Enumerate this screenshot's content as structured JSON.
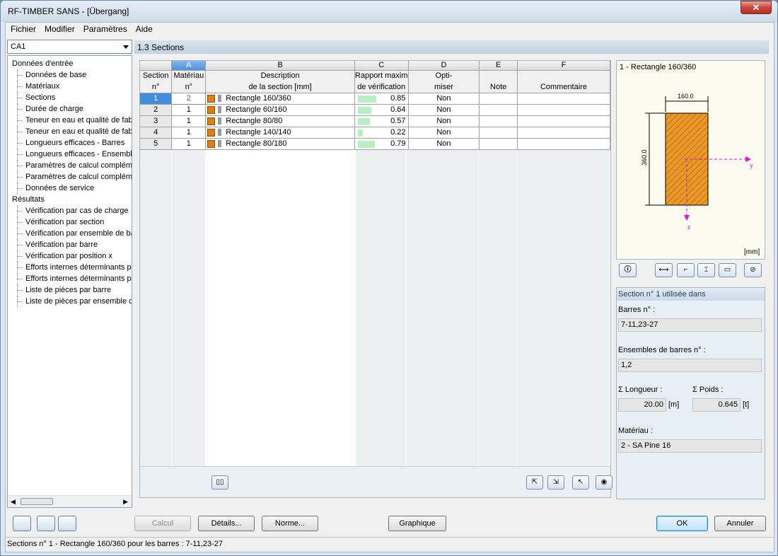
{
  "window": {
    "title": "RF-TIMBER SANS - [Übergang]",
    "close": "✕"
  },
  "menu": [
    "Fichier",
    "Modifier",
    "Paramètres",
    "Aide"
  ],
  "case_select": "CA1",
  "nav": {
    "input_root": "Données d'entrée",
    "input_items": [
      "Données de base",
      "Matériaux",
      "Sections",
      "Durée de charge",
      "Teneur en eau et qualité de fab",
      "Teneur en eau et qualité de fab",
      "Longueurs efficaces - Barres",
      "Longueurs efficaces - Ensemble",
      "Paramètres de calcul compléme",
      "Paramètres de calcul compléme",
      "Données de service"
    ],
    "results_root": "Résultats",
    "result_items": [
      "Vérification par cas de charge",
      "Vérification par section",
      "Vérification par ensemble de ba",
      "Vérification par barre",
      "Vérification par position x",
      "Efforts internes déterminants p",
      "Efforts internes déterminants p",
      "Liste de pièces par barre",
      "Liste de pièces par ensemble de"
    ]
  },
  "section_header": "1.3 Sections",
  "table": {
    "letters": [
      "A",
      "B",
      "C",
      "D",
      "E",
      "F"
    ],
    "h1": [
      "Section",
      "Matériau",
      "Description",
      "Rapport maxim",
      "Opti-",
      "",
      ""
    ],
    "h2": [
      "n°",
      "n°",
      "de la section [mm]",
      "de vérification",
      "miser",
      "Note",
      "Commentaire"
    ],
    "rows": [
      {
        "no": "1",
        "mat": "2",
        "desc": "Rectangle 160/360",
        "ratio": "0.85",
        "r": 0.85,
        "opt": "Non"
      },
      {
        "no": "2",
        "mat": "1",
        "desc": "Rectangle 60/160",
        "ratio": "0.64",
        "r": 0.64,
        "opt": "Non"
      },
      {
        "no": "3",
        "mat": "1",
        "desc": "Rectangle 80/80",
        "ratio": "0.57",
        "r": 0.57,
        "opt": "Non"
      },
      {
        "no": "4",
        "mat": "1",
        "desc": "Rectangle 140/140",
        "ratio": "0.22",
        "r": 0.22,
        "opt": "Non"
      },
      {
        "no": "5",
        "mat": "1",
        "desc": "Rectangle 80/180",
        "ratio": "0.79",
        "r": 0.79,
        "opt": "Non"
      }
    ]
  },
  "preview": {
    "title": "1 - Rectangle 160/360",
    "width_dim": "160.0",
    "height_dim": "360.0",
    "axis_y": "y",
    "axis_z": "z",
    "unit": "[mm]"
  },
  "info": {
    "header": "Section n° 1 utilisée dans",
    "barres_label": "Barres n° :",
    "barres_value": "7-11,23-27",
    "ensembles_label": "Ensembles de barres n° :",
    "ensembles_value": "1,2",
    "longueur_label": "Σ Longueur :",
    "longueur_value": "20.00",
    "longueur_unit": "[m]",
    "poids_label": "Σ Poids :",
    "poids_value": "0.645",
    "poids_unit": "[t]",
    "materiau_label": "Matériau :",
    "materiau_value": "2 - SA Pine 16"
  },
  "buttons": {
    "calcul": "Calcul",
    "details": "Détails...",
    "norme": "Norme...",
    "graphique": "Graphique",
    "ok": "OK",
    "annuler": "Annuler"
  },
  "status": "Sections n° 1 - Rectangle 160/360 pour les barres : 7-11,23-27",
  "colors": {
    "material": "#e07d13",
    "ratio_bar": "#b9f0c2",
    "selection": "#3f8ee0"
  }
}
